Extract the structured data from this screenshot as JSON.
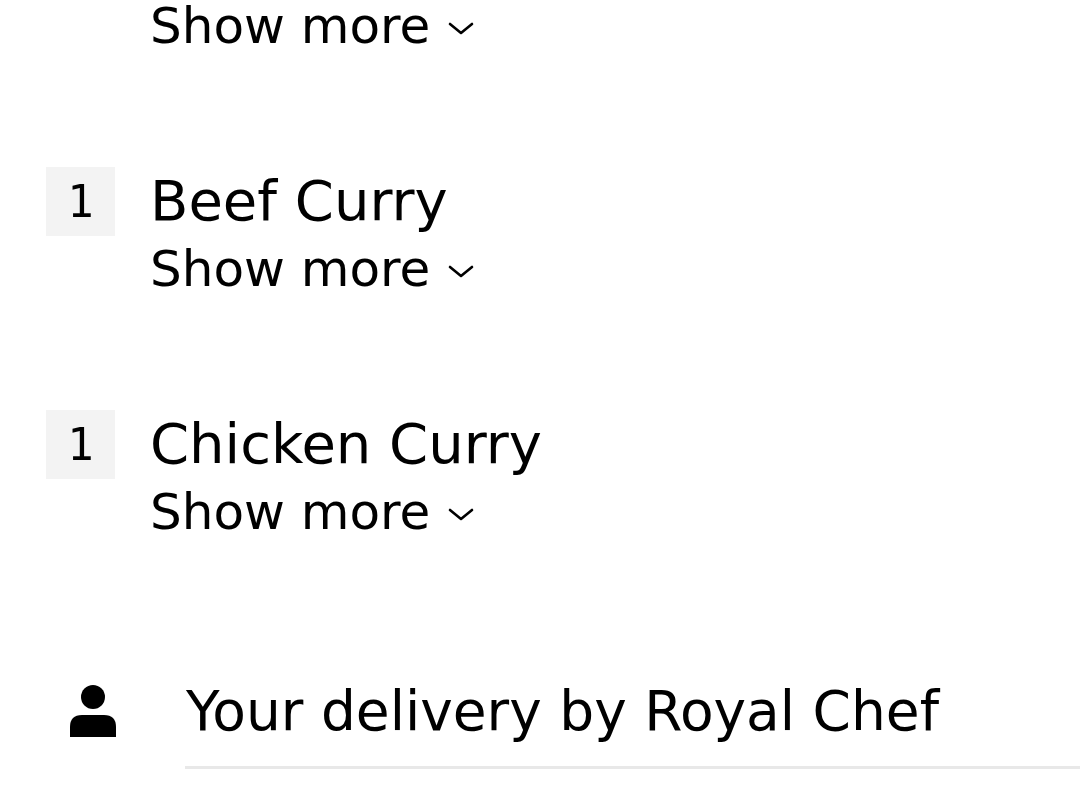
{
  "order_items": [
    {
      "show_more": "Show more"
    },
    {
      "quantity": "1",
      "name": "Beef Curry",
      "show_more": "Show more"
    },
    {
      "quantity": "1",
      "name": "Chicken Curry",
      "show_more": "Show more"
    }
  ],
  "delivery": {
    "text": "Your delivery by Royal Chef"
  }
}
